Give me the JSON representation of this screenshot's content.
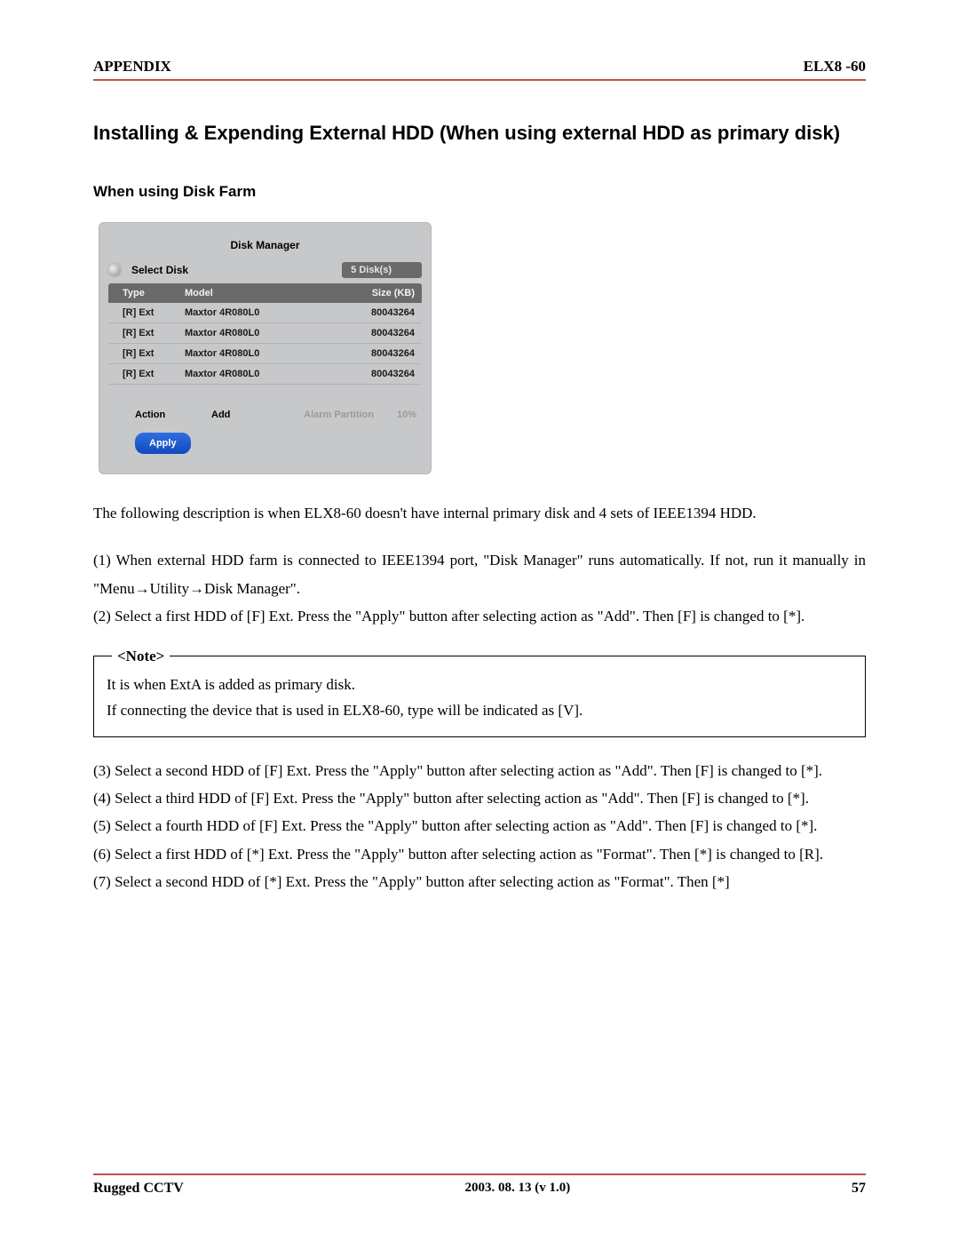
{
  "header": {
    "left": "APPENDIX",
    "right": "ELX8 -60"
  },
  "title": "Installing & Expending External HDD (When using external HDD as primary disk)",
  "subhead": "When using Disk Farm",
  "disk_manager": {
    "title": "Disk Manager",
    "select_label": "Select Disk",
    "disk_count": "5 Disk(s)",
    "columns": {
      "type": "Type",
      "model": "Model",
      "size": "Size (KB)"
    },
    "rows": [
      {
        "type": "[R] Ext",
        "model": "Maxtor 4R080L0",
        "size": "80043264"
      },
      {
        "type": "[R] Ext",
        "model": "Maxtor 4R080L0",
        "size": "80043264"
      },
      {
        "type": "[R] Ext",
        "model": "Maxtor 4R080L0",
        "size": "80043264"
      },
      {
        "type": "[R] Ext",
        "model": "Maxtor 4R080L0",
        "size": "80043264"
      }
    ],
    "action_label": "Action",
    "action_value": "Add",
    "alarm_label": "Alarm Partition",
    "alarm_value": "10%",
    "apply_label": "Apply"
  },
  "para_intro": "The following description is when ELX8-60 doesn't have internal primary disk and 4 sets of IEEE1394 HDD.",
  "steps_a": [
    "(1) When external HDD farm is connected to IEEE1394 port, \"Disk Manager\" runs automatically. If not, run it manually in \"Menu→Utility→Disk Manager\".",
    "(2) Select a first HDD of [F] Ext. Press the \"Apply\" button after selecting action as \"Add\". Then [F] is changed to [*]."
  ],
  "note": {
    "legend": "<Note>",
    "lines": [
      "It is when ExtA is added as primary disk.",
      "If connecting the device that is used in ELX8-60, type will be indicated as [V]."
    ]
  },
  "steps_b": [
    "(3) Select a second HDD of [F] Ext. Press the \"Apply\" button after selecting action as \"Add\". Then [F] is changed to [*].",
    "(4) Select a third HDD of [F] Ext. Press the \"Apply\" button after selecting action as \"Add\". Then [F] is changed to [*].",
    "(5) Select a fourth HDD of [F] Ext. Press the \"Apply\" button after selecting action as \"Add\". Then [F] is changed to [*].",
    "(6) Select a first HDD of [*] Ext. Press the \"Apply\" button after selecting action as \"Format\". Then [*] is changed to [R].",
    "(7) Select a second HDD of [*] Ext. Press the \"Apply\" button after selecting action as \"Format\". Then [*]"
  ],
  "footer": {
    "left": "Rugged CCTV",
    "mid": "2003. 08. 13 (v 1.0)",
    "right": "57"
  }
}
